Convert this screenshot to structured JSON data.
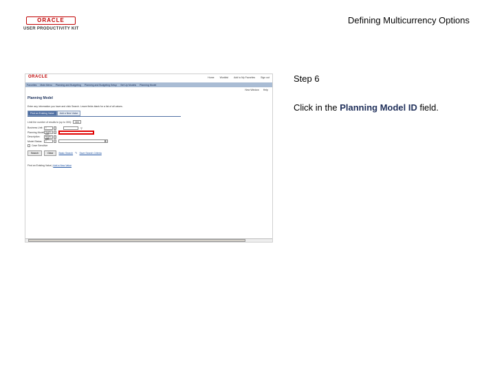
{
  "header": {
    "logo_top": "ORACLE",
    "logo_sub": "USER PRODUCTIVITY KIT",
    "title": "Defining Multicurrency Options"
  },
  "screenshot": {
    "brand": "ORACLE",
    "top_links": [
      "Home",
      "Worklist",
      "Add to My Favorites",
      "Sign out"
    ],
    "nav": [
      "Favorites",
      "Main Menu",
      "Planning and Budgeting",
      "Planning and Budgeting Setup",
      "Set Up Models",
      "Planning Model"
    ],
    "tools": [
      "New Window",
      "Help"
    ],
    "page_title": "Planning Model",
    "instructions": "Enter any information you have and click Search. Leave fields blank for a list of all values.",
    "tabs": [
      "Find an Existing Value",
      "Add a New Value"
    ],
    "limit_label": "Limit the number of results to (up to 300):",
    "limit_value": "300",
    "fields": [
      {
        "label": "Business Unit:",
        "operator": "="
      },
      {
        "label": "Planning Model ID:",
        "operator": "begins with"
      },
      {
        "label": "Description:",
        "operator": "begins with"
      },
      {
        "label": "Model Status:",
        "operator": "="
      }
    ],
    "case_sensitive": "Case Sensitive",
    "buttons": {
      "search": "Search",
      "clear": "Clear"
    },
    "links": {
      "basic": "Basic Search",
      "save": "Save Search Criteria"
    },
    "recent_label": "Find an Existing Value",
    "recent_link": "Add a New Value"
  },
  "step": {
    "label": "Step 6"
  },
  "instruction": {
    "before": "Click in the ",
    "bold": "Planning Model ID",
    "after": " field."
  },
  "colors": {
    "highlight": "#e00000",
    "nav": "#a9bcd4",
    "accent": "#4f6fa3"
  }
}
